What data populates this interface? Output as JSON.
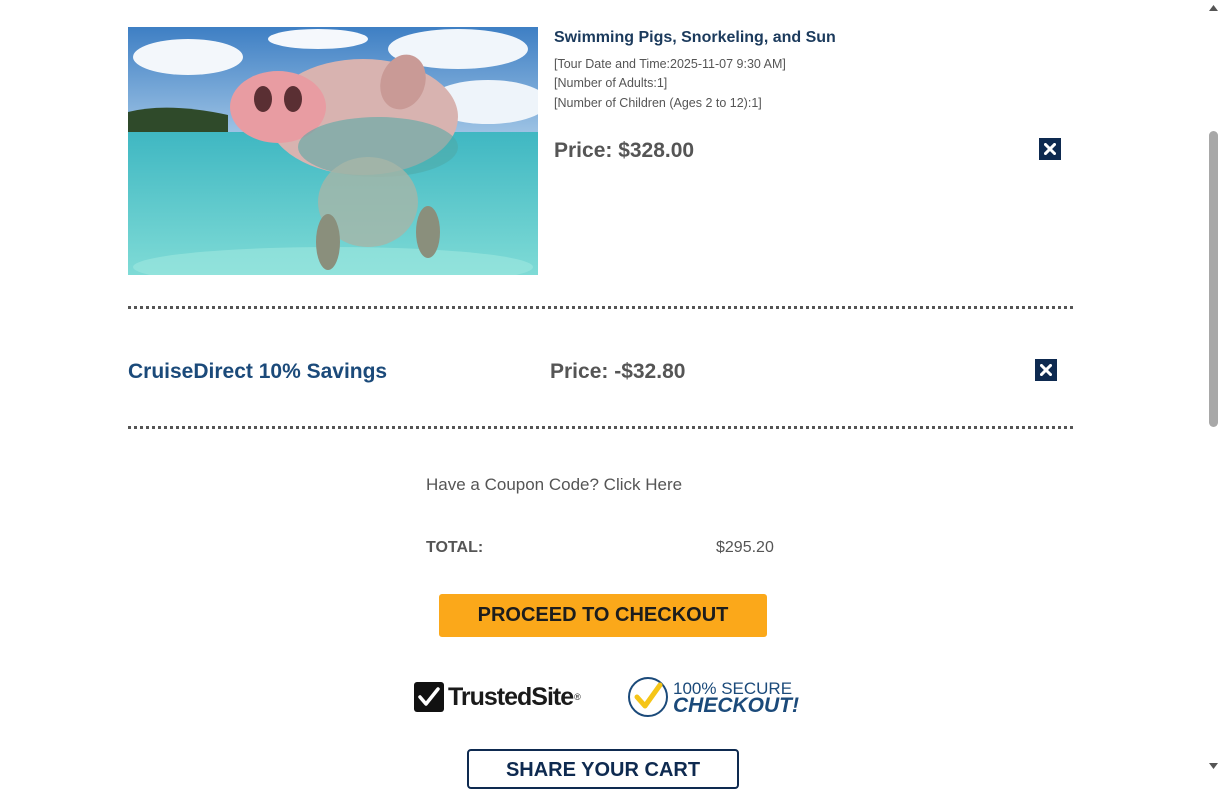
{
  "tour": {
    "title": "Swimming Pigs, Snorkeling, and Sun",
    "details": [
      "[Tour Date and Time:2025-11-07 9:30 AM]",
      "[Number of Adults:1]",
      "[Number of Children (Ages 2 to 12):1]"
    ],
    "price": "Price: $328.00",
    "remove_icon": "close-icon"
  },
  "discount": {
    "name": "CruiseDirect 10% Savings",
    "price": "Price: -$32.80",
    "remove_icon": "close-icon"
  },
  "coupon": {
    "link_text": "Have a Coupon Code? Click Here"
  },
  "total": {
    "label": "TOTAL:",
    "value": "$295.20"
  },
  "checkout": {
    "button_label": "PROCEED TO CHECKOUT"
  },
  "badges": {
    "trusted_site": "TrustedSite",
    "trusted_site_mark": "®",
    "secure_line1": "100% SECURE",
    "secure_line2": "CHECKOUT!"
  },
  "share": {
    "button_label": "SHARE YOUR CART"
  },
  "colors": {
    "brand_navy": "#0e2a50",
    "checkout_orange": "#fba81a",
    "discount_blue": "#1b4a7a",
    "secure_yellow": "#f5c518"
  }
}
